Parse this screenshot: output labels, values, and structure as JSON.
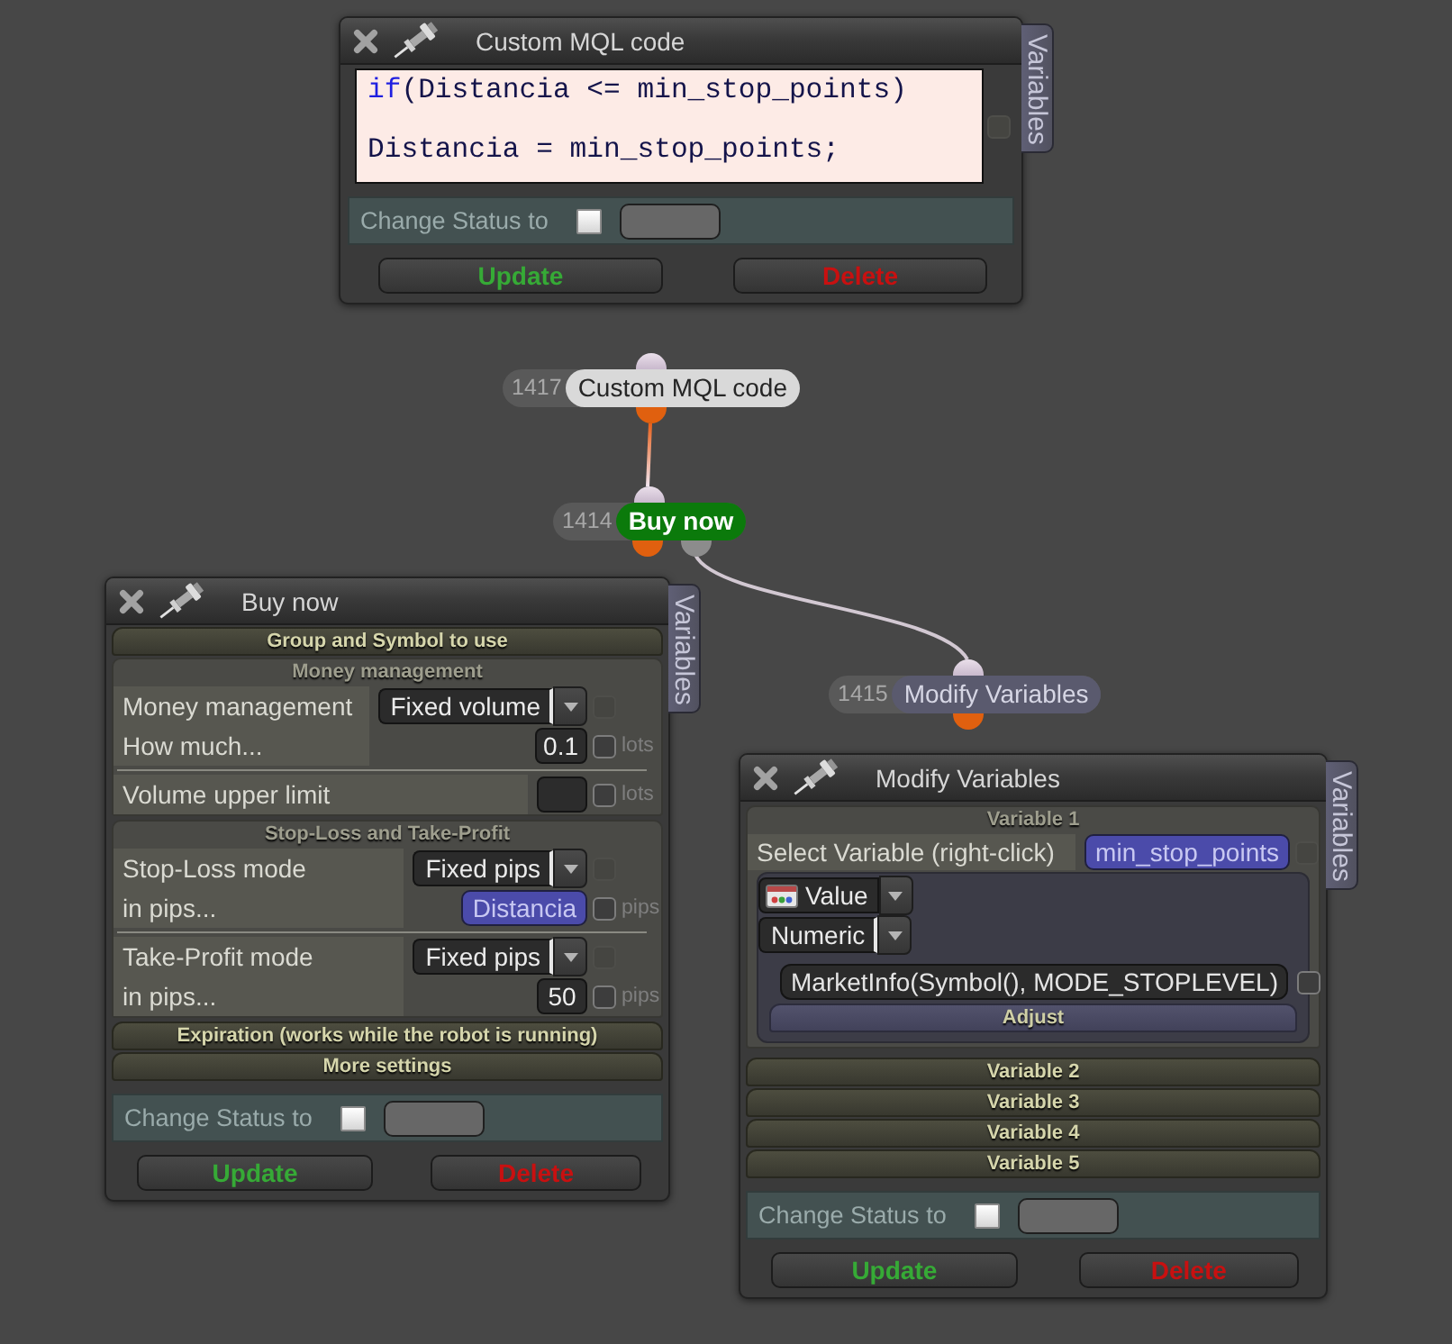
{
  "windows": [
    {
      "title": "Custom MQL code",
      "side_tab": "Variables",
      "code": {
        "lines": [
          {
            "tokens": [
              {
                "kind": "keyword",
                "text": "if"
              },
              {
                "kind": "plain",
                "text": "(Distancia <= min_stop_points)"
              }
            ]
          },
          {
            "tokens": [
              {
                "kind": "plain",
                "text": "Distancia = min_stop_points;"
              }
            ]
          }
        ],
        "checked": false,
        "disabled": true
      },
      "change_status": {
        "label": "Change Status to",
        "checked": false
      },
      "buttons": [
        {
          "kind": "update",
          "label": "Update"
        },
        {
          "kind": "delete",
          "label": "Delete"
        }
      ]
    },
    {
      "title": "Buy now",
      "side_tab": "Variables",
      "sections": [
        {
          "title": "Group and Symbol to use",
          "expanded": false
        },
        {
          "title": "Money management",
          "expanded": true,
          "groups": [
            [
              {
                "kind": "select",
                "label": "Money management",
                "value": "Fixed volume",
                "checked": false,
                "disabled": true
              },
              {
                "kind": "number",
                "label": "How much...",
                "value": "0.1",
                "checked": false,
                "disabled": false,
                "unit": "lots"
              }
            ],
            [
              {
                "kind": "number",
                "label": "Volume upper limit",
                "checked": false,
                "disabled": false,
                "unit": "lots"
              }
            ]
          ]
        },
        {
          "title": "Stop-Loss and Take-Profit",
          "expanded": true,
          "groups": [
            [
              {
                "kind": "select",
                "label": "Stop-Loss mode",
                "value": "Fixed pips",
                "checked": false,
                "disabled": true
              },
              {
                "kind": "variable",
                "label": "in pips...",
                "value": "Distancia",
                "checked": false,
                "disabled": false,
                "unit": "pips"
              }
            ],
            [
              {
                "kind": "select",
                "label": "Take-Profit mode",
                "value": "Fixed pips",
                "checked": false,
                "disabled": true
              },
              {
                "kind": "number",
                "label": "in pips...",
                "value": "50",
                "checked": false,
                "disabled": false,
                "unit": "pips"
              }
            ]
          ]
        },
        {
          "title": "Expiration (works while the robot is running)",
          "expanded": false
        },
        {
          "title": "More settings",
          "expanded": false
        }
      ],
      "change_status": {
        "label": "Change Status to",
        "checked": false
      },
      "buttons": [
        {
          "kind": "update",
          "label": "Update"
        },
        {
          "kind": "delete",
          "label": "Delete"
        }
      ]
    },
    {
      "title": "Modify Variables",
      "side_tab": "Variables",
      "sections": [
        {
          "title": "Variable 1",
          "expanded": true,
          "groups": [
            [
              {
                "kind": "variable",
                "label": "Select Variable (right-click)",
                "value": "min_stop_points",
                "checked": false,
                "disabled": true
              }
            ]
          ],
          "source": {
            "mode": "Value",
            "type": "Numeric",
            "expression": "MarketInfo(Symbol(), MODE_STOPLEVEL)",
            "checked": false,
            "disabled": false,
            "adjust": {
              "title": "Adjust",
              "expanded": false
            }
          }
        },
        {
          "title": "Variable 2",
          "expanded": false
        },
        {
          "title": "Variable 3",
          "expanded": false
        },
        {
          "title": "Variable 4",
          "expanded": false
        },
        {
          "title": "Variable 5",
          "expanded": false
        }
      ],
      "change_status": {
        "label": "Change Status to",
        "checked": false
      },
      "buttons": [
        {
          "kind": "update",
          "label": "Update"
        },
        {
          "kind": "delete",
          "label": "Delete"
        }
      ]
    }
  ],
  "nodes": [
    {
      "number": "1417",
      "label": "Custom MQL code",
      "kind": "code"
    },
    {
      "number": "1414",
      "label": "Buy now",
      "kind": "buy"
    },
    {
      "number": "1415",
      "label": "Modify Variables",
      "kind": "modify"
    }
  ]
}
